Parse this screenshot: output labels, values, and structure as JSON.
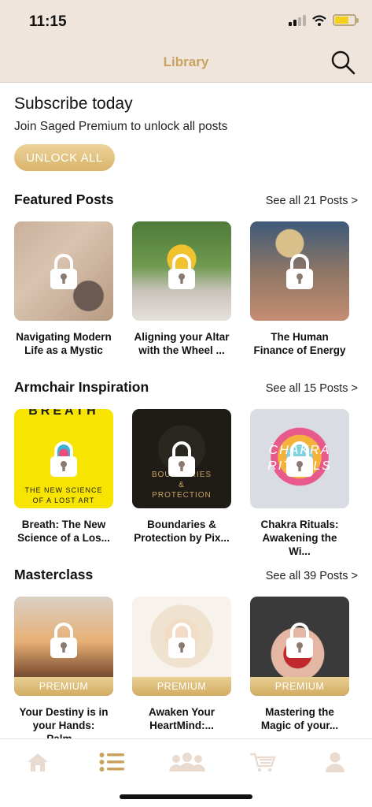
{
  "status_bar": {
    "time": "11:15"
  },
  "header": {
    "title": "Library",
    "search_icon": "search-icon"
  },
  "subscribe": {
    "title": "Subscribe today",
    "text": "Join Saged Premium to unlock all posts",
    "button": "UNLOCK ALL"
  },
  "sections": [
    {
      "title": "Featured Posts",
      "link": "See all 21 Posts >",
      "cards": [
        {
          "title": "Navigating Modern Life as a Mystic",
          "premium": false
        },
        {
          "title": "Aligning your Altar with the Wheel ...",
          "premium": false
        },
        {
          "title": "The Human Finance of Energy",
          "premium": false
        }
      ]
    },
    {
      "title": "Armchair Inspiration",
      "link": "See all 15 Posts >",
      "cards": [
        {
          "title": "Breath: The New Science of a Los...",
          "premium": false,
          "cover_text": [
            "BREATH",
            "THE NEW SCIENCE",
            "OF A LOST ART"
          ]
        },
        {
          "title": "Boundaries & Protection by Pix...",
          "premium": false,
          "cover_text": [
            "BOUNDARIES",
            "&",
            "PROTECTION"
          ]
        },
        {
          "title": "Chakra Rituals: Awakening the Wi...",
          "premium": false,
          "cover_text": [
            "CHAKRA",
            "RITUALS"
          ]
        }
      ]
    },
    {
      "title": "Masterclass",
      "link": "See all 39 Posts >",
      "cards": [
        {
          "title": "Your Destiny is in your Hands: Palm...",
          "premium": true,
          "badge": "PREMIUM"
        },
        {
          "title": "Awaken Your HeartMind:...",
          "premium": true,
          "badge": "PREMIUM"
        },
        {
          "title": "Mastering the Magic of your...",
          "premium": true,
          "badge": "PREMIUM"
        }
      ]
    }
  ],
  "tabbar": {
    "items": [
      {
        "icon": "home-icon",
        "active": false
      },
      {
        "icon": "list-icon",
        "active": true
      },
      {
        "icon": "community-icon",
        "active": false
      },
      {
        "icon": "cart-icon",
        "active": false
      },
      {
        "icon": "profile-icon",
        "active": false
      }
    ]
  },
  "colors": {
    "accent": "#c9a35e",
    "header_bg": "#efe5dd",
    "tab_inactive": "#eadbd0"
  }
}
